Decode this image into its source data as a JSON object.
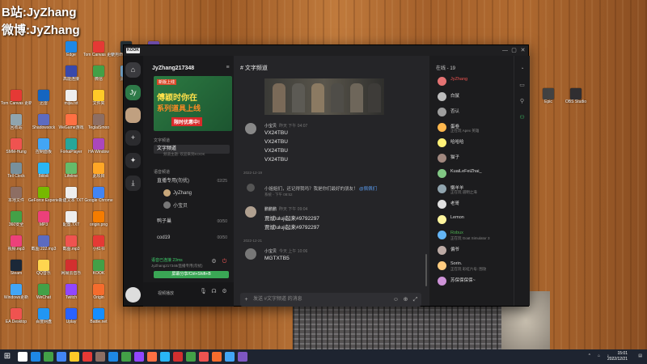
{
  "watermark": {
    "line1": "B站:JyZhang",
    "line2": "微博:JyZhang"
  },
  "desktop_icons": [
    {
      "label": "Edge",
      "color": "#1e88e5"
    },
    {
      "label": "Tom Canvas 更新",
      "color": "#e53935"
    },
    {
      "label": "使用命令 可以选择",
      "color": "#263238"
    },
    {
      "label": "111.png",
      "color": "#7e57c2"
    },
    {
      "label": "高能连接",
      "color": "#3949ab"
    },
    {
      "label": "微信",
      "color": "#43a047"
    },
    {
      "label": "此电脑",
      "color": "#90caf9"
    },
    {
      "label": "WeGame",
      "color": "#f57c00"
    },
    {
      "label": "Tom Canvas 更新",
      "color": "#e53935"
    },
    {
      "label": "迅雷",
      "color": "#1565c0"
    },
    {
      "label": "mijia.txt",
      "color": "#eeeeee"
    },
    {
      "label": "文件夹",
      "color": "#ffca28"
    },
    {
      "label": "回收站",
      "color": "#90a4ae"
    },
    {
      "label": "Shadowsock",
      "color": "#5c6bc0"
    },
    {
      "label": "WeGame游戏",
      "color": "#ff7043"
    },
    {
      "label": "TeglaiSmoo",
      "color": "#8d6e63"
    },
    {
      "label": "SMM-Hung",
      "color": "#ef5350"
    },
    {
      "label": "控制面板",
      "color": "#42a5f5"
    },
    {
      "label": "ForkaPlayer",
      "color": "#26a69a"
    },
    {
      "label": "HA Window",
      "color": "#ab47bc"
    },
    {
      "label": "Tell Clock",
      "color": "#78909c"
    },
    {
      "label": "Bilibili",
      "color": "#29b6f6"
    },
    {
      "label": "Lifeline",
      "color": "#66bb6a"
    },
    {
      "label": "此项目",
      "color": "#ffa726"
    },
    {
      "label": "本地文件",
      "color": "#8d6e63"
    },
    {
      "label": "GeForce Experience",
      "color": "#76b900"
    },
    {
      "label": "新建文本 TXT",
      "color": "#eeeeee"
    },
    {
      "label": "Google Chrome",
      "color": "#4285f4"
    },
    {
      "label": "360安全",
      "color": "#43a047"
    },
    {
      "label": "MP3",
      "color": "#ec407a"
    },
    {
      "label": "配置.TXT",
      "color": "#eeeeee"
    },
    {
      "label": "origin.png",
      "color": "#f57c00"
    },
    {
      "label": "视频.mp3",
      "color": "#ec407a"
    },
    {
      "label": "截图 222.mp3",
      "color": "#5c6bc0"
    },
    {
      "label": "截图.mp3",
      "color": "#ef5350"
    },
    {
      "label": "小红书",
      "color": "#e53935"
    },
    {
      "label": "Steam",
      "color": "#1b2838"
    },
    {
      "label": "QQ音乐",
      "color": "#ffd54f"
    },
    {
      "label": "网易云音乐",
      "color": "#d32f2f"
    },
    {
      "label": "KOOK",
      "color": "#43a047"
    },
    {
      "label": "Windows更新",
      "color": "#42a5f5"
    },
    {
      "label": "WeChat",
      "color": "#43a047"
    },
    {
      "label": "Twitch",
      "color": "#9146ff"
    },
    {
      "label": "Origin",
      "color": "#f56c2d"
    },
    {
      "label": "EA Desktop",
      "color": "#ef5350"
    },
    {
      "label": "百度网盘",
      "color": "#2196f3"
    },
    {
      "label": "Uplay",
      "color": "#2962ff"
    },
    {
      "label": "Battle.net",
      "color": "#148eff"
    },
    {
      "label": "Epic",
      "color": "#424242"
    },
    {
      "label": "OBS Studio",
      "color": "#302e31"
    }
  ],
  "window": {
    "logo": "KOOK",
    "controls": [
      "—",
      "▢",
      "✕"
    ],
    "guild_name": "JyZhang217348",
    "banner": {
      "tag": "新版上线",
      "line1": "傅颖时你在",
      "line2": "系列道具上线",
      "line3": "限时优惠中!"
    },
    "categories": [
      {
        "label": "文字频道"
      },
      {
        "label": "语音频道"
      }
    ],
    "channels": [
      {
        "name": "文字频道",
        "sub": "频道主题: 欢迎来到KOOK",
        "active": true,
        "count": ""
      },
      {
        "name": "直播专用(勿扰)",
        "sub": "",
        "active": false,
        "count": "02/25"
      },
      {
        "name": "鸭子巢",
        "sub": "",
        "active": false,
        "count": "00/50"
      },
      {
        "name": "cod19",
        "sub": "",
        "active": false,
        "count": "00/50"
      }
    ],
    "voice_users": [
      "JyZhang",
      "小宝贝"
    ],
    "voice_panel": {
      "status": "语音已连接 23ms",
      "sub": "JyZhang217348/直播专用(勿扰)",
      "button": "屏幕分享/Ctrl+Shift+B"
    },
    "user_bar": {
      "name": "视频播放"
    },
    "chat": {
      "header": "文字频道",
      "messages": [
        {
          "author": "小宝贝",
          "time": "昨天 下午 04:07",
          "lines": [
            "VX24TBU",
            "VX24TBU",
            "VX24TBU",
            "VX24TBU"
          ],
          "color": "#777"
        },
        {
          "author": "鹏鹏鹏",
          "time": "昨天 下午 09:04",
          "lines": [
            "贾斌luluji起来#9792297",
            "贾斌luluji起来#9792297"
          ],
          "color": "#b0a090"
        },
        {
          "author": "小宝贝",
          "time": "今天 上午 10:06",
          "lines": [
            "MGTXTB5"
          ],
          "color": "#777"
        }
      ],
      "day_separators": [
        "2022-12-19",
        "2022-12-21"
      ],
      "system": {
        "text": "小姐姐们，还记得我吗？我是你们最好的朋友！",
        "link": "@佩佩们",
        "sub": "系统 - 下午 08:52"
      },
      "input_placeholder": "发送 #文字频道 的消息"
    },
    "members": {
      "header": "在线 - 19",
      "list": [
        {
          "name": "JyZhang",
          "game": "",
          "color": "#e57373",
          "name_color": "#ef5350"
        },
        {
          "name": "白鼠",
          "game": "",
          "color": "#bdbdbd",
          "name_color": "#ddd"
        },
        {
          "name": "否认",
          "game": "",
          "color": "#9e9e9e",
          "name_color": "#ddd"
        },
        {
          "name": "蛋卷",
          "game": "正在玩 Apex 英雄",
          "color": "#ffb74d",
          "name_color": "#ddd"
        },
        {
          "name": "哈哈哈",
          "game": "",
          "color": "#fff176",
          "name_color": "#ddd"
        },
        {
          "name": "猫子",
          "game": "",
          "color": "#a1887f",
          "name_color": "#ddd"
        },
        {
          "name": "KuaiLeFeiZhai_",
          "game": "",
          "color": "#81c784",
          "name_color": "#ddd"
        },
        {
          "name": "懒羊羊",
          "game": "正在玩 道明之海",
          "color": "#90a4ae",
          "name_color": "#ddd"
        },
        {
          "name": "老哥",
          "game": "",
          "color": "#e0e0e0",
          "name_color": "#ddd"
        },
        {
          "name": "Lemon",
          "game": "",
          "color": "#fff59d",
          "name_color": "#ddd"
        },
        {
          "name": "Robux",
          "game": "正在玩 Goat Simulator 3",
          "color": "#64b5f6",
          "name_color": "#4caf50"
        },
        {
          "name": "偏爷",
          "game": "",
          "color": "#bcaaa4",
          "name_color": "#ddd"
        },
        {
          "name": "Sorin.",
          "game": "正在玩 彩虹六号: 围攻",
          "color": "#ffcc80",
          "name_color": "#ddd"
        },
        {
          "name": "苏保保保保~",
          "game": "",
          "color": "#ce93d8",
          "name_color": "#ddd"
        }
      ]
    }
  },
  "taskbar": {
    "time": "15:01",
    "date": "2022/12/21",
    "apps": [
      "#ffffff",
      "#1e88e5",
      "#43a047",
      "#4285f4",
      "#ffca28",
      "#e53935",
      "#8d6e63",
      "#1e88e5",
      "#43a047",
      "#9146ff",
      "#ff7043",
      "#29b6f6",
      "#d32f2f",
      "#43a047",
      "#ef5350",
      "#f56c2d",
      "#42a5f5",
      "#7e57c2"
    ]
  }
}
